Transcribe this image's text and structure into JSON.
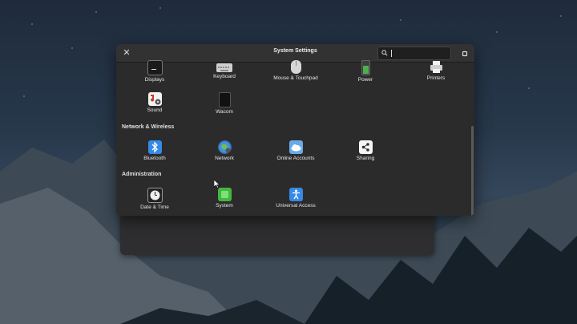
{
  "window": {
    "title": "System Settings",
    "search_placeholder": ""
  },
  "hardware_row1": [
    {
      "label": "Displays",
      "icon": "display-icon"
    },
    {
      "label": "Keyboard",
      "icon": "keyboard-icon"
    },
    {
      "label": "Mouse & Touchpad",
      "icon": "mouse-icon"
    },
    {
      "label": "Power",
      "icon": "battery-icon"
    },
    {
      "label": "Printers",
      "icon": "printer-icon"
    }
  ],
  "hardware_row2": [
    {
      "label": "Sound",
      "icon": "sound-icon"
    },
    {
      "label": "Wacom",
      "icon": "tablet-icon"
    }
  ],
  "sections": {
    "network": "Network & Wireless",
    "administration": "Administration"
  },
  "network_items": [
    {
      "label": "Bluetooth",
      "icon": "bluetooth-icon"
    },
    {
      "label": "Network",
      "icon": "network-icon"
    },
    {
      "label": "Online Accounts",
      "icon": "cloud-icon"
    },
    {
      "label": "Sharing",
      "icon": "share-icon"
    }
  ],
  "admin_items": [
    {
      "label": "Date & Time",
      "icon": "clock-icon"
    },
    {
      "label": "System",
      "icon": "system-icon"
    },
    {
      "label": "Universal Access",
      "icon": "accessibility-icon"
    }
  ],
  "colors": {
    "window_bg": "#2b2b2b",
    "accent_blue": "#3689e6",
    "system_green": "#43b83f"
  }
}
